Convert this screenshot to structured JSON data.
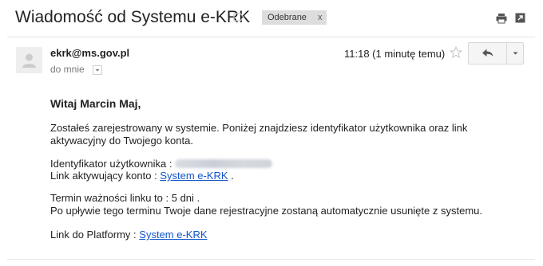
{
  "header": {
    "subject": "Wiadomość od Systemu e-KRK",
    "inbox_label": "Odebrane",
    "inbox_label_close": "x",
    "icons": [
      "label-tag-icon",
      "print-icon",
      "new-window-icon"
    ]
  },
  "message": {
    "sender": "ekrk@ms.gov.pl",
    "recipient": "do mnie",
    "time": "11:18 (1 minutę temu)",
    "icons": [
      "avatar-icon",
      "dropdown-icon",
      "star-icon",
      "reply-icon",
      "more-dropdown-icon"
    ]
  },
  "body": {
    "greeting": "Witaj Marcin Maj,",
    "para1_line1": "Zostałeś zarejestrowany w systemie. Poniżej znajdziesz identyfikator użytkownika oraz link",
    "para1_line2": "aktywacyjny do Twojego konta.",
    "identifier_label": "Identyfikator użytkownika :",
    "activation_label": "Link aktywujący konto :",
    "activation_link": "System e-KRK",
    "activation_suffix": ".",
    "expiry_line1": "Termin ważności linku to : 5 dni .",
    "expiry_line2": "Po upływie tego terminu Twoje dane rejestracyjne zostaną automatycznie usunięte z systemu.",
    "platform_label": "Link do Platformy :",
    "platform_link": "System e-KRK"
  },
  "colors": {
    "link": "#1155cc",
    "text": "#222222",
    "muted": "#777777",
    "chip_bg": "#dddddd"
  }
}
